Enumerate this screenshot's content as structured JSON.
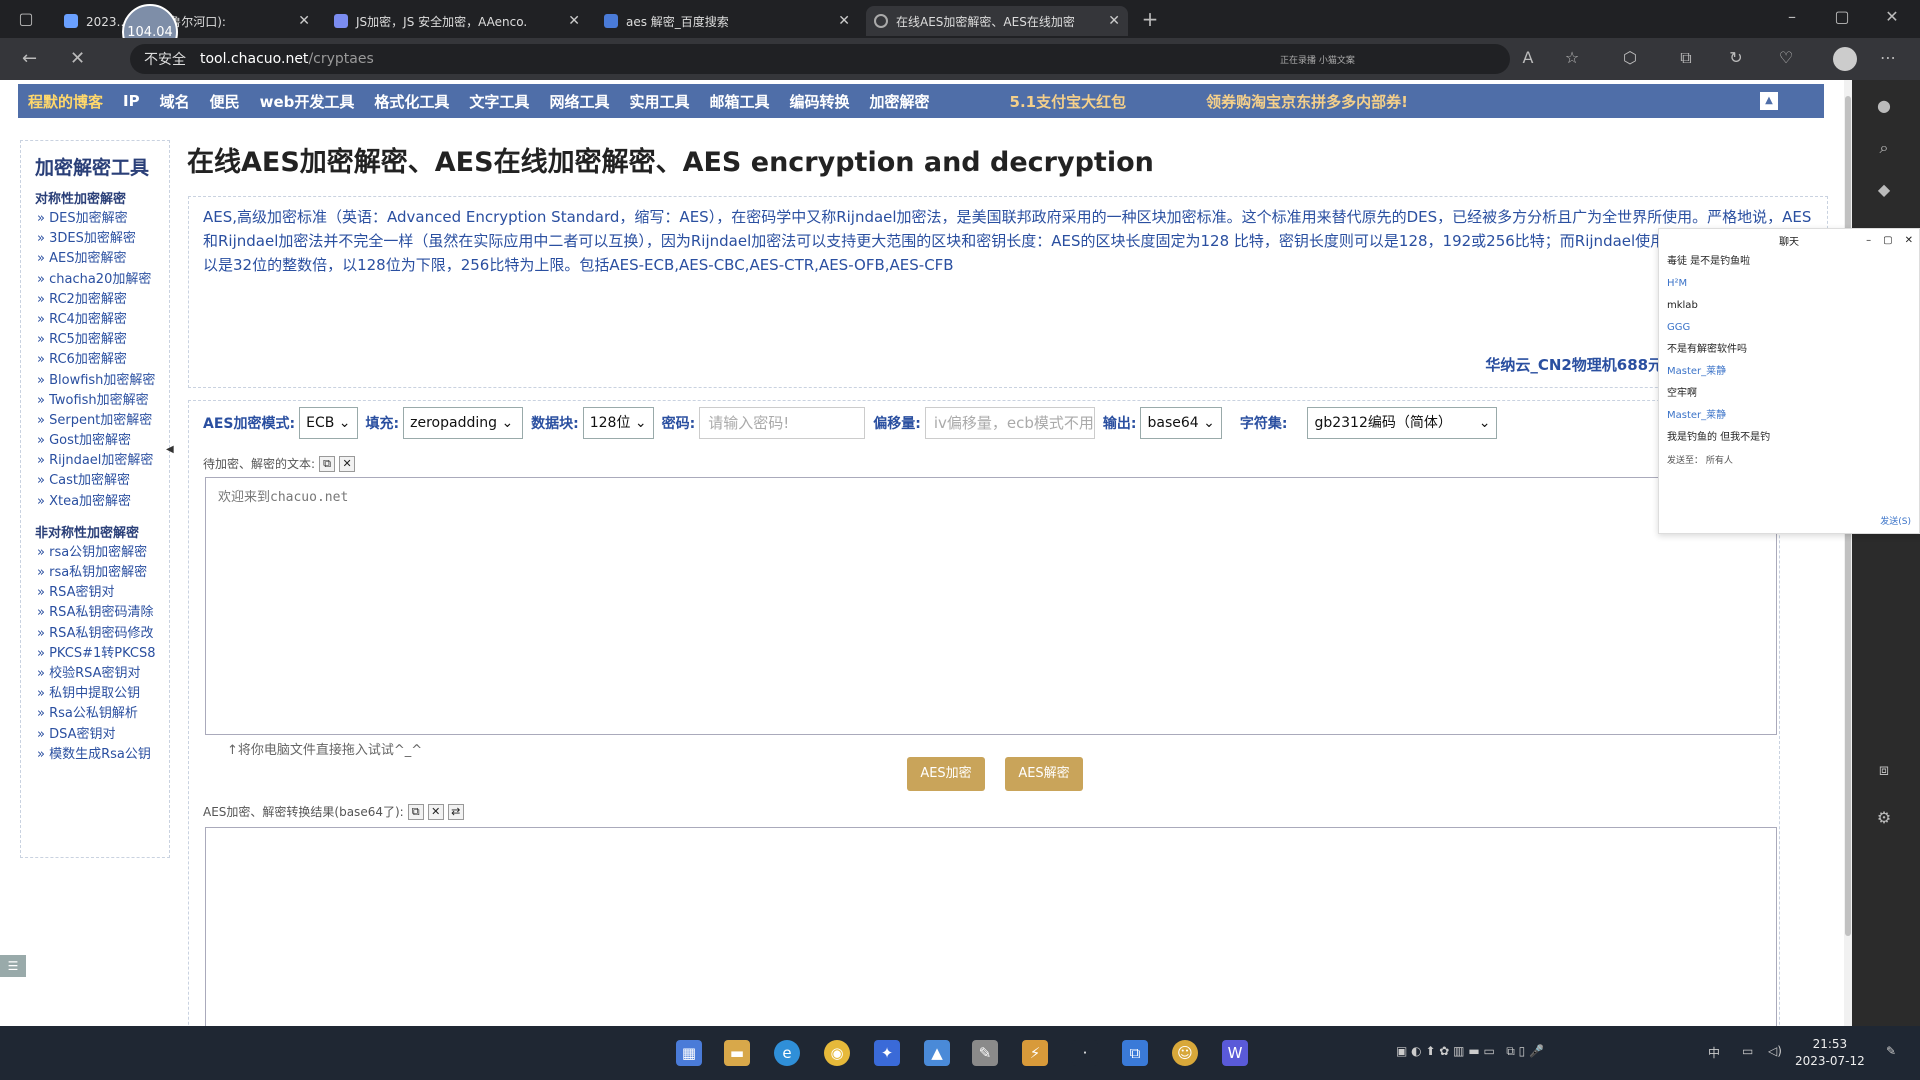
{
  "browser": {
    "tabs": [
      {
        "label": "2023…东风港(鲁尔河口):"
      },
      {
        "label": "JS加密，JS 安全加密，AAenco."
      },
      {
        "label": "aes 解密_百度搜索"
      },
      {
        "label": "在线AES加密解密、AES在线加密"
      }
    ],
    "overlay_badge": "104.04",
    "url_insecure": "不安全",
    "url_domain": "tool.chacuo.net",
    "url_path": "/cryptaes",
    "address_status": "正在录播 小猫文案"
  },
  "topnav": {
    "brand": "程默的博客",
    "items": [
      "IP",
      "域名",
      "便民",
      "web开发工具",
      "格式化工具",
      "文字工具",
      "网络工具",
      "实用工具",
      "邮箱工具",
      "编码转换",
      "加密解密"
    ],
    "promo1": "5.1支付宝大红包",
    "promo2": "领券购淘宝京东拼多多内部券!"
  },
  "sidebar": {
    "title": "加密解密工具",
    "group1": "对称性加密解密",
    "symmetric": [
      "DES加密解密",
      "3DES加密解密",
      "AES加密解密",
      "chacha20加解密",
      "RC2加密解密",
      "RC4加密解密",
      "RC5加密解密",
      "RC6加密解密",
      "Blowfish加密解密",
      "Twofish加密解密",
      "Serpent加密解密",
      "Gost加密解密",
      "Rijndael加密解密",
      "Cast加密解密",
      "Xtea加密解密"
    ],
    "group2": "非对称性加密解密",
    "asymmetric": [
      "rsa公钥加密解密",
      "rsa私钥加密解密",
      "RSA密钥对",
      "RSA私钥密码清除",
      "RSA私钥密码修改",
      "PKCS#1转PKCS8",
      "校验RSA密钥对",
      "私钥中提取公钥",
      "Rsa公私钥解析",
      "DSA密钥对",
      "模数生成Rsa公钥"
    ]
  },
  "main": {
    "title": "在线AES加密解密、AES在线加密解密、AES encryption and decryption",
    "intro": "AES,高级加密标准（英语：Advanced Encryption Standard，缩写：AES），在密码学中又称Rijndael加密法，是美国联邦政府采用的一种区块加密标准。这个标准用来替代原先的DES，已经被多方分析且广为全世界所使用。严格地说，AES和Rijndael加密法并不完全一样（虽然在实际应用中二者可以互换），因为Rijndael加密法可以支持更大范围的区块和密钥长度：AES的区块长度固定为128 比特，密钥长度则可以是128，192或256比特；而Rijndael使用的密钥和区块长度可以是32位的整数倍，以128位为下限，256比特为上限。包括AES-ECB,AES-CBC,AES-CTR,AES-OFB,AES-CFB",
    "ad": "华纳云_CN2物理机688元_10M CN2云24元/月"
  },
  "form": {
    "mode_label": "AES加密模式:",
    "mode_value": "ECB",
    "padding_label": "填充:",
    "padding_value": "zeropadding",
    "block_label": "数据块:",
    "block_value": "128位",
    "password_label": "密码:",
    "password_placeholder": "请输入密码!",
    "offset_label": "偏移量:",
    "offset_placeholder": "iv偏移量，ecb模式不用填写!",
    "output_label": "输出:",
    "output_value": "base64",
    "charset_label": "字符集:",
    "charset_value": "gb2312编码（简体）",
    "input_label": "待加密、解密的文本:",
    "input_text": "欢迎来到chacuo.net",
    "hint": "↑将你电脑文件直接拖入试试^_^",
    "encrypt_button": "AES加密",
    "decrypt_button": "AES解密",
    "result_label": "AES加密、解密转换结果(base64了):"
  },
  "chat": {
    "title": "聊天",
    "messages": [
      {
        "text": "毒徒 是不是钓鱼啦"
      },
      {
        "text": "H²M",
        "name": true
      },
      {
        "text": "mklab"
      },
      {
        "text": "GGG",
        "name": true
      },
      {
        "text": "不是有解密软件吗"
      },
      {
        "text": "Master_莱静",
        "name": true
      },
      {
        "text": "空牢啊"
      },
      {
        "text": "Master_莱静",
        "name": true
      },
      {
        "text": "我是钓鱼的 但我不是钓"
      }
    ],
    "send_to": "发送至：  所有人",
    "send_button": "发送(S)"
  },
  "taskbar": {
    "time": "21:53",
    "date": "2023-07-12",
    "ime": "中"
  }
}
